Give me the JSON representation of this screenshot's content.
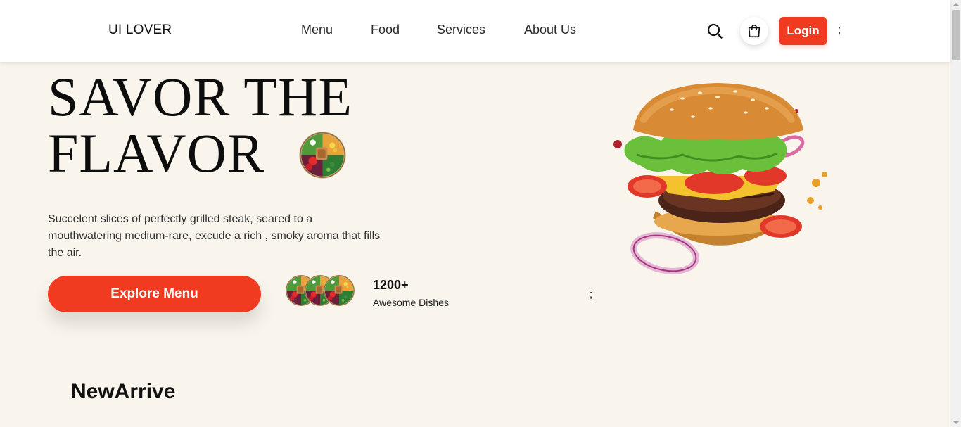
{
  "header": {
    "logo": "UI LOVER",
    "nav": [
      {
        "label": "Menu"
      },
      {
        "label": "Food"
      },
      {
        "label": "Services"
      },
      {
        "label": "About Us"
      }
    ],
    "login_label": "Login",
    "stray_text": ";",
    "icons": {
      "search": "search-icon",
      "cart": "shopping-bag-icon"
    }
  },
  "hero": {
    "title_line1": "SAVOR THE",
    "title_line2": "FLAVOR",
    "description": "Succelent slices of perfectly grilled steak, seared to a mouthwatering medium-rare, excude a rich , smoky aroma that fills the air.",
    "cta_label": "Explore Menu",
    "stat_value": "1200+",
    "stat_label": "Awesome Dishes",
    "stray_text": ";"
  },
  "section": {
    "title": "NewArrive"
  },
  "colors": {
    "accent": "#f13b21",
    "background": "#f9f5ec",
    "header_bg": "#ffffff"
  }
}
